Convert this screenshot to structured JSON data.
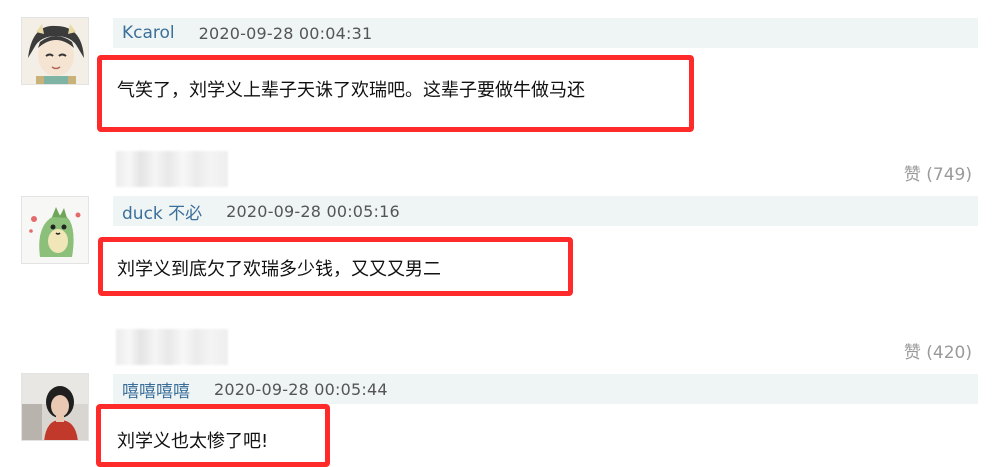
{
  "comments": [
    {
      "user": "Kcarol",
      "time": "2020-09-28 00:04:31",
      "text": "气笑了，刘学义上辈子天诛了欢瑞吧。这辈子要做牛做马还",
      "likes": "赞 (749)"
    },
    {
      "user": "duck 不必",
      "time": "2020-09-28 00:05:16",
      "text": "刘学义到底欠了欢瑞多少钱，又又又男二",
      "likes": "赞 (420)"
    },
    {
      "user": "嘻嘻嘻嘻",
      "time": "2020-09-28 00:05:44",
      "text": "刘学义也太惨了吧!"
    }
  ],
  "colors": {
    "highlight": "#ff2a2a",
    "username": "#3d6f9b",
    "meta_bg": "#eef5f4"
  },
  "icons": [
    "avatar-anime-character",
    "avatar-green-dinosaur",
    "avatar-photo-person"
  ]
}
